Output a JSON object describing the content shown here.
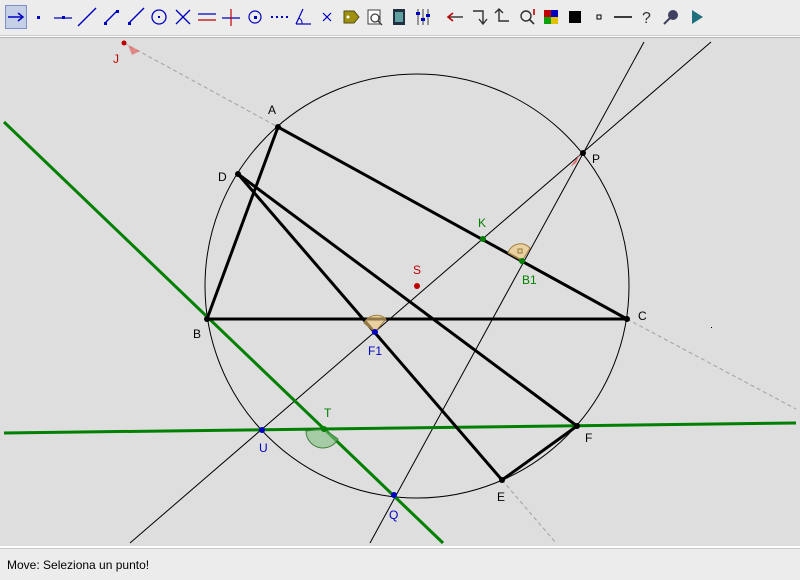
{
  "toolbar": {
    "tools": [
      {
        "name": "move-tool",
        "active": true
      },
      {
        "name": "new-point-tool"
      },
      {
        "name": "point-on-line-tool"
      },
      {
        "name": "line-through-two-points-tool"
      },
      {
        "name": "segment-tool"
      },
      {
        "name": "ray-tool"
      },
      {
        "name": "circle-with-center-tool"
      },
      {
        "name": "intersect-tool"
      },
      {
        "name": "parallel-line-tool"
      },
      {
        "name": "perpendicular-line-tool"
      },
      {
        "name": "midpoint-tool"
      },
      {
        "name": "polygon-tool"
      },
      {
        "name": "angle-tool"
      },
      {
        "name": "delete-tool"
      },
      {
        "name": "label-tool"
      },
      {
        "name": "relation-tool"
      },
      {
        "name": "macro-tool"
      },
      {
        "name": "properties-tool"
      },
      {
        "name": "undo-tool"
      },
      {
        "name": "redo-tool"
      },
      {
        "name": "back-tool"
      },
      {
        "name": "check-tool"
      },
      {
        "name": "color-tool"
      },
      {
        "name": "filled-tool"
      },
      {
        "name": "point-style-tool"
      },
      {
        "name": "line-style-tool"
      },
      {
        "name": "help-tool"
      },
      {
        "name": "zoom-tool"
      },
      {
        "name": "animate-tool"
      }
    ]
  },
  "points": {
    "J": "J",
    "A": "A",
    "D": "D",
    "P": "P",
    "K": "K",
    "B1": "B1",
    "S": "S",
    "B": "B",
    "C": "C",
    "F1": "F1",
    "T": "T",
    "U": "U",
    "F": "F",
    "E": "E",
    "Q": "Q"
  },
  "colors": {
    "canvas": "#dedede",
    "black": "#000000",
    "green": "#008000",
    "blue": "#0000c0",
    "red": "#c00000",
    "dashed": "#a0a0a0",
    "angle_fill": "#f0c878",
    "angle_green": "#80c080"
  },
  "status": {
    "message": "Move: Seleziona un punto!"
  }
}
